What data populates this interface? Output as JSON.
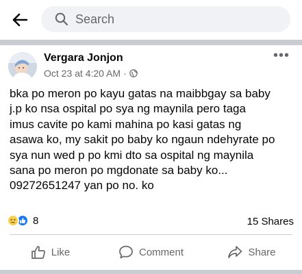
{
  "search": {
    "placeholder": "Search",
    "back_icon": "back-arrow-icon",
    "search_icon": "magnifier-icon"
  },
  "post": {
    "author": "Vergara Jonjon",
    "timestamp": "Oct 23 at 4:20 AM",
    "separator": "·",
    "privacy_icon": "globe-icon",
    "more_label": "•••",
    "text_lines": [
      "bka po meron po kayu gatas na maibbgay sa baby",
      "j.p ko nsa ospital po sya ng maynila pero taga",
      "imus cavite po kami mahina po kasi gatas ng",
      "asawa ko, my sakit po baby ko ngaun ndehyrate po",
      "sya nun wed p po kmi dto sa ospital ng maynila",
      "sana po meron po mgdonate sa baby ko...",
      "09272651247  yan po no. ko"
    ],
    "reactions": {
      "types": [
        "sad",
        "like"
      ],
      "count": "8"
    },
    "shares": "15 Shares"
  },
  "actions": {
    "like": "Like",
    "comment": "Comment",
    "share": "Share"
  },
  "colors": {
    "text": "#050505",
    "secondary": "#65676b",
    "search_bg": "#f0f2f5",
    "separator": "#c9ccd1",
    "like_blue": "#1877f2",
    "sad_yellow": "#f7d14c"
  }
}
